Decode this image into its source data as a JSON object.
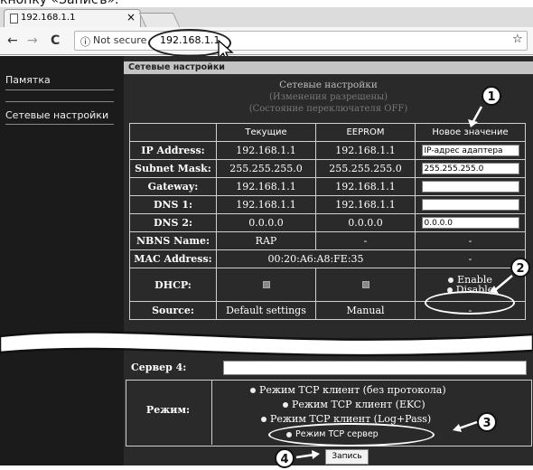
{
  "caption": "кнопку «Записъ».",
  "browser": {
    "tab_title": "192.168.1.1",
    "tab_close": "×",
    "back": "←",
    "forward": "→",
    "reload": "C",
    "info_icon": "ⓘ",
    "not_secure": "Not secure",
    "url": "192.168.1.1",
    "star": "☆"
  },
  "sidebar": {
    "items": [
      {
        "label": "Памятка"
      },
      {
        "label": "Сетевые настройки"
      }
    ]
  },
  "main": {
    "header": "Сетевые настройки",
    "notes": [
      "Сетевые настройки",
      "(Изменения разрешены)",
      "(Состояние переключателя OFF)"
    ],
    "table": {
      "headers": [
        "",
        "Текущие",
        "EEPROM",
        "Новое значение"
      ],
      "rows": [
        {
          "label": "IP Address:",
          "current": "192.168.1.1",
          "eeprom": "192.168.1.1",
          "new": "IP-адрес адаптера"
        },
        {
          "label": "Subnet Mask:",
          "current": "255.255.255.0",
          "eeprom": "255.255.255.0",
          "new": "255.255.255.0"
        },
        {
          "label": "Gateway:",
          "current": "192.168.1.1",
          "eeprom": "192.168.1.1",
          "new": ""
        },
        {
          "label": "DNS 1:",
          "current": "192.168.1.1",
          "eeprom": "192.168.1.1",
          "new": ""
        },
        {
          "label": "DNS 2:",
          "current": "0.0.0.0",
          "eeprom": "0.0.0.0",
          "new": "0.0.0.0"
        },
        {
          "label": "NBNS Name:",
          "current": "RAP",
          "eeprom": "-",
          "new": "-"
        },
        {
          "label": "MAC Address:",
          "mac": "00:20:A6:A8:FE:35",
          "new": "-"
        },
        {
          "label": "DHCP:",
          "enable": "Enable",
          "disable": "Disable"
        },
        {
          "label": "Source:",
          "current": "Default settings",
          "eeprom": "Manual",
          "new": "-"
        }
      ]
    },
    "server4_label": "Сервер 4:",
    "mode": {
      "label": "Режим:",
      "options": [
        "Режим TCP клиент (без протокола)",
        "Режим TCP клиент (EKC)",
        "Режим TCP клиент (Log+Pass)",
        "Режим TCP сервер"
      ]
    },
    "save_button": "Запись"
  },
  "badges": [
    "1",
    "2",
    "3",
    "4"
  ]
}
